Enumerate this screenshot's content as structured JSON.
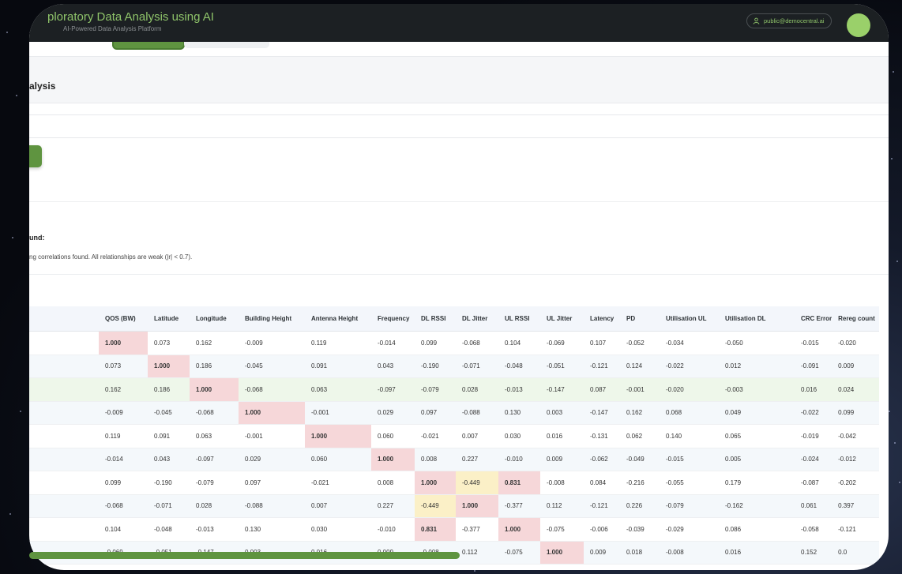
{
  "header": {
    "title": "ploratory Data Analysis using AI",
    "subtitle": "AI-Powered Data Analysis Platform",
    "user_email": "public@democentral.ai"
  },
  "section": {
    "title": "alysis"
  },
  "correlations": {
    "found_title": "und:",
    "found_text": "ng correlations found. All relationships are weak (|r| < 0.7)."
  },
  "table": {
    "columns": [
      "QOS (BW)",
      "Latitude",
      "Longitude",
      "Building Height",
      "Antenna Height",
      "Frequency",
      "DL RSSI",
      "DL Jitter",
      "UL RSSI",
      "UL Jitter",
      "Latency",
      "PD",
      "Utilisation UL",
      "Utilisation DL",
      "CRC Error",
      "Rereg count"
    ],
    "rows": [
      [
        "1.000",
        "0.073",
        "0.162",
        "-0.009",
        "0.119",
        "-0.014",
        "0.099",
        "-0.068",
        "0.104",
        "-0.069",
        "0.107",
        "-0.052",
        "-0.034",
        "-0.050",
        "-0.015",
        "-0.020"
      ],
      [
        "0.073",
        "1.000",
        "0.186",
        "-0.045",
        "0.091",
        "0.043",
        "-0.190",
        "-0.071",
        "-0.048",
        "-0.051",
        "-0.121",
        "0.124",
        "-0.022",
        "0.012",
        "-0.091",
        "0.009"
      ],
      [
        "0.162",
        "0.186",
        "1.000",
        "-0.068",
        "0.063",
        "-0.097",
        "-0.079",
        "0.028",
        "-0.013",
        "-0.147",
        "0.087",
        "-0.001",
        "-0.020",
        "-0.003",
        "0.016",
        "0.024"
      ],
      [
        "-0.009",
        "-0.045",
        "-0.068",
        "1.000",
        "-0.001",
        "0.029",
        "0.097",
        "-0.088",
        "0.130",
        "0.003",
        "-0.147",
        "0.162",
        "0.068",
        "0.049",
        "-0.022",
        "0.099"
      ],
      [
        "0.119",
        "0.091",
        "0.063",
        "-0.001",
        "1.000",
        "0.060",
        "-0.021",
        "0.007",
        "0.030",
        "0.016",
        "-0.131",
        "0.062",
        "0.140",
        "0.065",
        "-0.019",
        "-0.042"
      ],
      [
        "-0.014",
        "0.043",
        "-0.097",
        "0.029",
        "0.060",
        "1.000",
        "0.008",
        "0.227",
        "-0.010",
        "0.009",
        "-0.062",
        "-0.049",
        "-0.015",
        "0.005",
        "-0.024",
        "-0.012"
      ],
      [
        "0.099",
        "-0.190",
        "-0.079",
        "0.097",
        "-0.021",
        "0.008",
        "1.000",
        "-0.449",
        "0.831",
        "-0.008",
        "0.084",
        "-0.216",
        "-0.055",
        "0.179",
        "-0.087",
        "-0.202"
      ],
      [
        "-0.068",
        "-0.071",
        "0.028",
        "-0.088",
        "0.007",
        "0.227",
        "-0.449",
        "1.000",
        "-0.377",
        "0.112",
        "-0.121",
        "0.226",
        "-0.079",
        "-0.162",
        "0.061",
        "0.397"
      ],
      [
        "0.104",
        "-0.048",
        "-0.013",
        "0.130",
        "0.030",
        "-0.010",
        "0.831",
        "-0.377",
        "1.000",
        "-0.075",
        "-0.006",
        "-0.039",
        "-0.029",
        "0.086",
        "-0.058",
        "-0.121"
      ],
      [
        "-0.069",
        "-0.051",
        "-0.147",
        "0.003",
        "0.016",
        "0.009",
        "-0.008",
        "0.112",
        "-0.075",
        "1.000",
        "0.009",
        "0.018",
        "-0.008",
        "0.016",
        "0.152",
        "0.0"
      ]
    ],
    "highlight_color": "#f6d7d9",
    "moderate_color": "#fbf0c7"
  },
  "colors": {
    "accent": "#5f9440",
    "header_bg": "#1c2023"
  }
}
